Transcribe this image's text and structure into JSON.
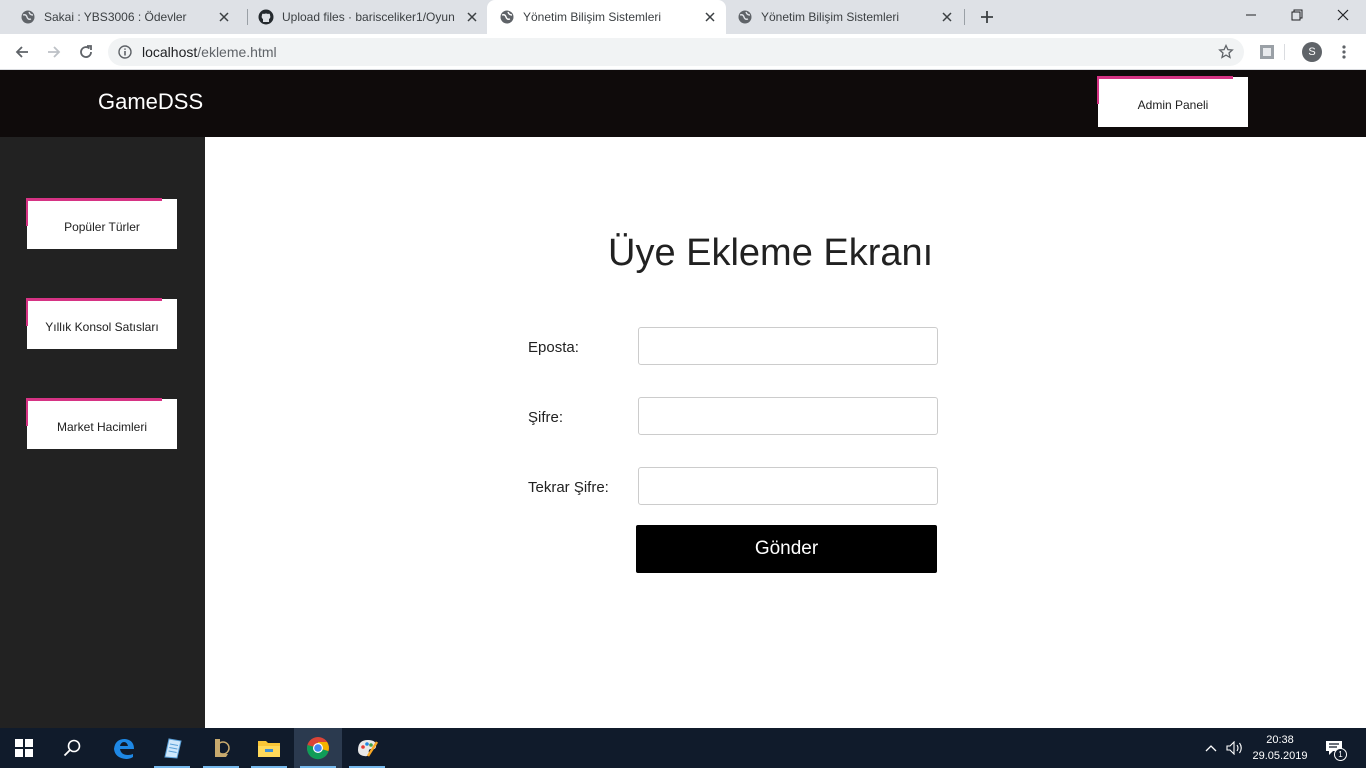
{
  "browser": {
    "tabs": [
      {
        "title": "Sakai : YBS3006 : Ödevler",
        "icon": "globe-icon"
      },
      {
        "title": "Upload files · barisceliker1/Oyun",
        "icon": "github-icon"
      },
      {
        "title": "Yönetim Bilişim Sistemleri",
        "icon": "globe-icon",
        "active": true
      },
      {
        "title": "Yönetim Bilişim Sistemleri",
        "icon": "globe-icon"
      }
    ],
    "url_host": "localhost",
    "url_path": "/ekleme.html",
    "profile_initial": "S"
  },
  "navbar": {
    "brand": "GameDSS",
    "admin_button": "Admin Paneli",
    "accent_color": "#d63384"
  },
  "sidebar": {
    "items": [
      {
        "label": "Popüler Türler"
      },
      {
        "label": "Yıllık Konsol Satısları"
      },
      {
        "label": "Market Hacimleri"
      }
    ]
  },
  "form": {
    "title": "Üye Ekleme Ekranı",
    "fields": [
      {
        "label": "Eposta:",
        "value": "",
        "placeholder": ""
      },
      {
        "label": "Şifre:",
        "value": "",
        "placeholder": ""
      },
      {
        "label": "Tekrar Şifre:",
        "value": "",
        "placeholder": ""
      }
    ],
    "submit_label": "Gönder"
  },
  "taskbar": {
    "time": "20:38",
    "date": "29.05.2019",
    "notification_count": "1",
    "apps": [
      "start-icon",
      "search-icon",
      "edge-icon",
      "notepad-icon",
      "league-icon",
      "file-explorer-icon",
      "chrome-icon",
      "paint-icon"
    ]
  }
}
